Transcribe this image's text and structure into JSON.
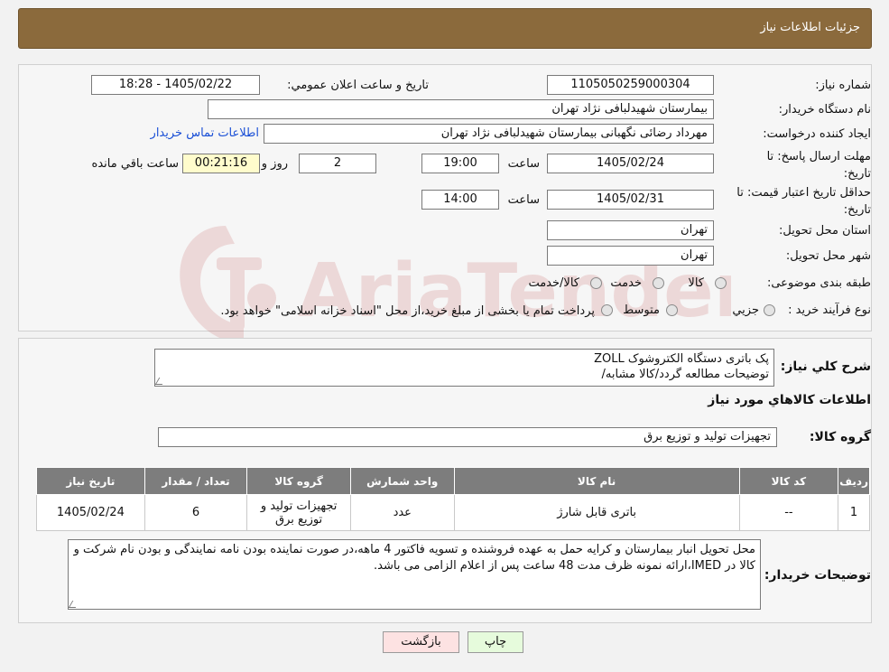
{
  "header": {
    "title": "جزئیات اطلاعات نیاز"
  },
  "form": {
    "need_number_label": "شماره نیاز:",
    "need_number": "1105050259000304",
    "announce_label": "تاریخ و ساعت اعلان عمومي:",
    "announce_value": "1405/02/22 - 18:28",
    "buyer_org_label": "نام دستگاه خریدار:",
    "buyer_org": "بیمارستان شهیدلبافی نژاد تهران",
    "creator_label": "ایجاد کننده درخواست:",
    "creator": "مهرداد رضائی نگهبانی بیمارستان شهیدلبافی نژاد تهران",
    "contact_link": "اطلاعات تماس خریدار",
    "reply_deadline_label_1": "مهلت ارسال پاسخ: تا",
    "reply_deadline_label_2": "تاریخ:",
    "reply_date": "1405/02/24",
    "time_label": "ساعت",
    "reply_time": "19:00",
    "days_value": "2",
    "days_label": "روز و",
    "remaining_time": "00:21:16",
    "remaining_label": "ساعت باقي مانده",
    "validity_label_1": "حداقل تاریخ اعتبار قیمت: تا",
    "validity_label_2": "تاریخ:",
    "validity_date": "1405/02/31",
    "validity_time": "14:00",
    "province_label": "استان محل تحویل:",
    "province": "تهران",
    "city_label": "شهر محل تحویل:",
    "city": "تهران",
    "category_label": "طبقه بندی موضوعی:",
    "category_options": [
      "کالا",
      "خدمت",
      "کالا/خدمت"
    ],
    "process_label": "نوع فرآیند خرید :",
    "process_options": [
      "جزیي",
      "متوسط"
    ],
    "process_note": "پرداخت تمام یا بخشی از مبلغ خرید،از محل \"اسناد خزانه اسلامی\" خواهد بود."
  },
  "details": {
    "summary_label": "شرح کلي نیاز:",
    "summary_line1": "پک باتری دستگاه الکتروشوک ZOLL",
    "summary_line2": "توضیحات مطالعه گردد/کالا مشابه/",
    "goods_info_title": "اطلاعات کالاهاي مورد نیاز",
    "goods_group_label": "گروه کالا:",
    "goods_group": "تجهیزات تولید و توزیع برق"
  },
  "table": {
    "headers": [
      "ردیف",
      "کد کالا",
      "نام کالا",
      "واحد شمارش",
      "گروه کالا",
      "تعداد / مقدار",
      "تاریخ نیاز"
    ],
    "rows": [
      [
        "1",
        "--",
        "باتری قابل شارژ",
        "عدد",
        "تجهیزات تولید و توزیع برق",
        "6",
        "1405/02/24"
      ]
    ]
  },
  "buyer_notes": {
    "label": "توضیحات خریدار:",
    "text": "محل تحویل انبار بیمارستان و کرایه حمل به عهده فروشنده و تسویه فاکتور 4 ماهه،در صورت نماینده بودن نامه نمایندگی و بودن نام شرکت و کالا در IMED،ارائه نمونه ظرف مدت 48 ساعت پس از اعلام الزامی می باشد."
  },
  "buttons": {
    "print": "چاپ",
    "back": "بازگشت"
  },
  "colors": {
    "header_bg": "#8b6a3c",
    "table_header_bg": "#7d7d7d",
    "link": "#1a4fd6"
  },
  "icons": {
    "watermark": "ariatender-logo-watermark",
    "resize": "resize-grip-icon"
  }
}
